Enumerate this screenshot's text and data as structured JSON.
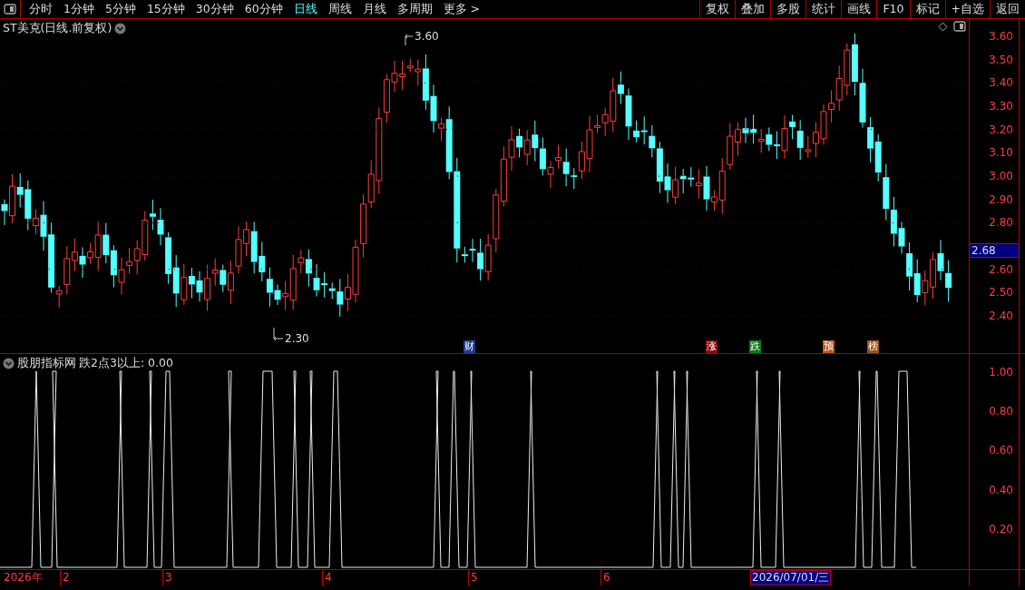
{
  "toolbar": {
    "periods": [
      {
        "label": "分时",
        "selected": false
      },
      {
        "label": "1分钟",
        "selected": false
      },
      {
        "label": "5分钟",
        "selected": false
      },
      {
        "label": "15分钟",
        "selected": false
      },
      {
        "label": "30分钟",
        "selected": false
      },
      {
        "label": "60分钟",
        "selected": false
      },
      {
        "label": "日线",
        "selected": true
      },
      {
        "label": "周线",
        "selected": false
      },
      {
        "label": "月线",
        "selected": false
      },
      {
        "label": "多周期",
        "selected": false
      },
      {
        "label": "更多 >",
        "selected": false
      }
    ],
    "buttons": [
      "复权",
      "叠加",
      "多股",
      "统计",
      "画线",
      "F10",
      "标记",
      "+自选",
      "返回"
    ]
  },
  "price_chart": {
    "title": "ST美克(日线.前复权)",
    "axis_labels": [
      "3.60",
      "3.50",
      "3.40",
      "3.30",
      "3.20",
      "3.10",
      "3.00",
      "2.90",
      "2.80",
      "2.60",
      "2.50",
      "2.40"
    ],
    "current_price": "2.68",
    "high_label": "3.60",
    "low_label": "2.30",
    "events": [
      {
        "label": "财",
        "color": "#1c3f8c"
      },
      {
        "label": "涨",
        "color": "#8b0a0a"
      },
      {
        "label": "跌",
        "color": "#0b7a12"
      },
      {
        "label": "预",
        "color": "#c2561a"
      },
      {
        "label": "榜",
        "color": "#9a5214"
      }
    ]
  },
  "indicator": {
    "name": "股朋指标网",
    "reading": "跌2点3以上: 0.00",
    "axis_labels": [
      "1.00",
      "0.80",
      "0.60",
      "0.40",
      "0.20"
    ]
  },
  "date_axis": {
    "labels": [
      "2026年",
      "2",
      "3",
      "4",
      "5",
      "6"
    ],
    "cursor_date": "2026/07/01/三"
  }
}
